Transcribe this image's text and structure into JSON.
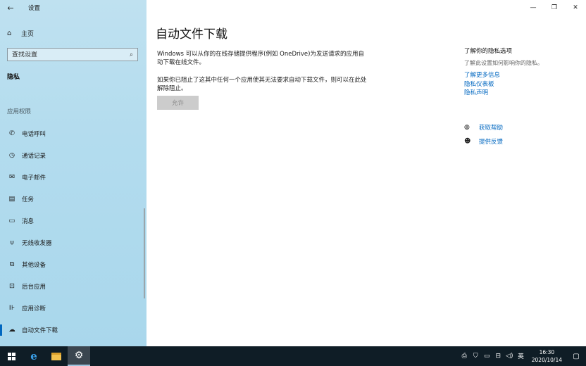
{
  "window": {
    "title": "设置",
    "back_icon": "arrow-left-icon",
    "controls": [
      "minimize-icon",
      "restore-icon",
      "close-icon"
    ]
  },
  "sidebar": {
    "home_label": "主页",
    "search": {
      "placeholder": "查找设置",
      "value": ""
    },
    "section_title": "隐私",
    "group_title": "应用权限",
    "items": [
      {
        "label": "电话呼叫",
        "icon": "phone-icon"
      },
      {
        "label": "通话记录",
        "icon": "call-history-icon"
      },
      {
        "label": "电子邮件",
        "icon": "mail-icon"
      },
      {
        "label": "任务",
        "icon": "tasks-icon"
      },
      {
        "label": "消息",
        "icon": "message-icon"
      },
      {
        "label": "无线收发器",
        "icon": "radio-icon"
      },
      {
        "label": "其他设备",
        "icon": "devices-icon"
      },
      {
        "label": "后台应用",
        "icon": "background-apps-icon"
      },
      {
        "label": "应用诊断",
        "icon": "diagnostics-icon"
      },
      {
        "label": "自动文件下载",
        "icon": "cloud-icon",
        "active": true
      }
    ]
  },
  "main": {
    "title": "自动文件下载",
    "description": "Windows 可以从你的在线存储提供程序(例如 OneDrive)为发送请求的应用自动下载在线文件。",
    "description2": "如果你已阻止了这其中任何一个应用使其无法要求自动下载文件，则可以在此处解除阻止。",
    "allow_button": "允许"
  },
  "right_panel": {
    "heading": "了解你的隐私选项",
    "subtext": "了解此设置如何影响你的隐私。",
    "links": [
      "了解更多信息",
      "隐私仪表板",
      "隐私声明"
    ],
    "help": [
      {
        "label": "获取帮助",
        "icon": "help-chat-icon"
      },
      {
        "label": "提供反馈",
        "icon": "feedback-icon"
      }
    ]
  },
  "taskbar": {
    "apps": [
      "windows-start-icon",
      "edge-icon",
      "file-explorer-icon",
      "settings-gear-icon"
    ],
    "tray_icons": [
      "action-icon",
      "defender-icon",
      "display-icon",
      "network-icon",
      "volume-icon"
    ],
    "language": "英",
    "time": "16:30",
    "date": "2020/10/14"
  },
  "colors": {
    "sidebar_bg": "#b3dcee",
    "accent": "#0067c0",
    "taskbar_bg": "#0f1d26",
    "disabled_button": "#cccccc"
  }
}
